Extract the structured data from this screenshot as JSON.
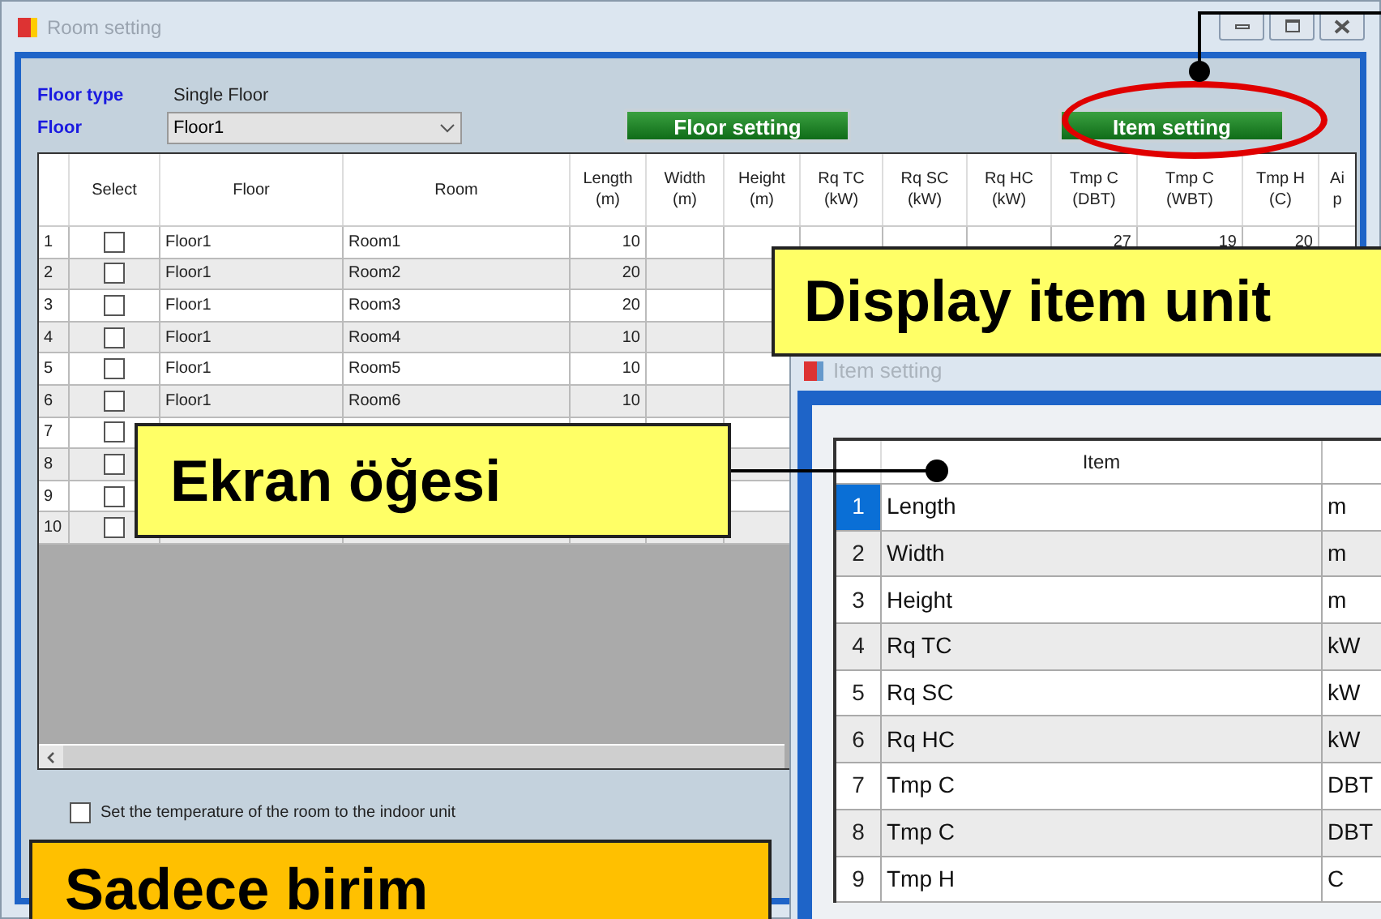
{
  "main_window": {
    "title": "Room setting",
    "floor_type_label": "Floor type",
    "floor_type_value": "Single Floor",
    "floor_label": "Floor",
    "floor_value": "Floor1",
    "buttons": [
      {
        "label": "Floor setting"
      },
      {
        "label": "Item setting"
      }
    ],
    "table": {
      "columns": [
        {},
        {
          "lines": [
            "Select"
          ]
        },
        {
          "lines": [
            "Floor"
          ]
        },
        {
          "lines": [
            "Room"
          ]
        },
        {
          "lines": [
            "Length",
            "(m)"
          ]
        },
        {
          "lines": [
            "Width",
            "(m)"
          ]
        },
        {
          "lines": [
            "Height",
            "(m)"
          ]
        },
        {
          "lines": [
            "Rq TC",
            "(kW)"
          ]
        },
        {
          "lines": [
            "Rq SC",
            "(kW)"
          ]
        },
        {
          "lines": [
            "Rq HC",
            "(kW)"
          ]
        },
        {
          "lines": [
            "Tmp C",
            "(DBT)"
          ]
        },
        {
          "lines": [
            "Tmp C",
            "(WBT)"
          ]
        },
        {
          "lines": [
            "Tmp H",
            "(C)"
          ]
        },
        {
          "lines": [
            "Ai",
            "p"
          ]
        }
      ],
      "rows": [
        {
          "cells": [
            "1",
            "",
            "Floor1",
            "Room1",
            "10",
            "",
            "",
            "",
            "",
            "",
            "27",
            "19",
            "20",
            ""
          ],
          "checked": false
        },
        {
          "cells": [
            "2",
            "",
            "Floor1",
            "Room2",
            "20",
            "",
            "",
            "",
            "",
            "",
            "",
            "",
            "",
            ""
          ],
          "checked": false
        },
        {
          "cells": [
            "3",
            "",
            "Floor1",
            "Room3",
            "20",
            "",
            "",
            "",
            "",
            "",
            "",
            "",
            "",
            ""
          ],
          "checked": false
        },
        {
          "cells": [
            "4",
            "",
            "Floor1",
            "Room4",
            "10",
            "",
            "",
            "",
            "",
            "",
            "",
            "",
            "",
            ""
          ],
          "checked": false
        },
        {
          "cells": [
            "5",
            "",
            "Floor1",
            "Room5",
            "10",
            "",
            "",
            "",
            "",
            "",
            "",
            "",
            "",
            ""
          ],
          "checked": false
        },
        {
          "cells": [
            "6",
            "",
            "Floor1",
            "Room6",
            "10",
            "",
            "",
            "",
            "",
            "",
            "",
            "",
            "",
            ""
          ],
          "checked": false
        },
        {
          "cells": [
            "7",
            "",
            "",
            "",
            "",
            "",
            "",
            "",
            "",
            "",
            "",
            "",
            "",
            ""
          ],
          "checked": false
        },
        {
          "cells": [
            "8",
            "",
            "",
            "",
            "",
            "",
            "",
            "",
            "",
            "",
            "",
            "",
            "",
            ""
          ],
          "checked": false
        },
        {
          "cells": [
            "9",
            "",
            "",
            "",
            "",
            "",
            "",
            "",
            "",
            "",
            "",
            "",
            "",
            ""
          ],
          "checked": false
        },
        {
          "cells": [
            "10",
            "",
            "",
            "",
            "",
            "",
            "",
            "",
            "",
            "",
            "",
            "",
            "",
            ""
          ],
          "checked": false
        }
      ]
    },
    "option": {
      "label": "Set the temperature of the room to the indoor unit",
      "checked": false
    }
  },
  "item_window": {
    "title": "Item setting",
    "header": "Item",
    "rows": [
      {
        "number": "1",
        "item": "Length",
        "unit": "m",
        "selected": true
      },
      {
        "number": "2",
        "item": "Width",
        "unit": "m",
        "selected": false
      },
      {
        "number": "3",
        "item": "Height",
        "unit": "m",
        "selected": false
      },
      {
        "number": "4",
        "item": "Rq TC",
        "unit": "kW",
        "selected": false
      },
      {
        "number": "5",
        "item": "Rq SC",
        "unit": "kW",
        "selected": false
      },
      {
        "number": "6",
        "item": "Rq HC",
        "unit": "kW",
        "selected": false
      },
      {
        "number": "7",
        "item": "Tmp C",
        "unit": "DBT",
        "selected": false
      },
      {
        "number": "8",
        "item": "Tmp C",
        "unit": "DBT",
        "selected": false
      },
      {
        "number": "9",
        "item": "Tmp H",
        "unit": "C",
        "selected": false
      }
    ]
  },
  "callouts": [
    {
      "text": "Display item unit",
      "color": "#ffff66"
    },
    {
      "text": "Ekran öğesi",
      "color": "#ffff66"
    },
    {
      "text": "Sadece birim",
      "color": "#ffc000"
    }
  ]
}
